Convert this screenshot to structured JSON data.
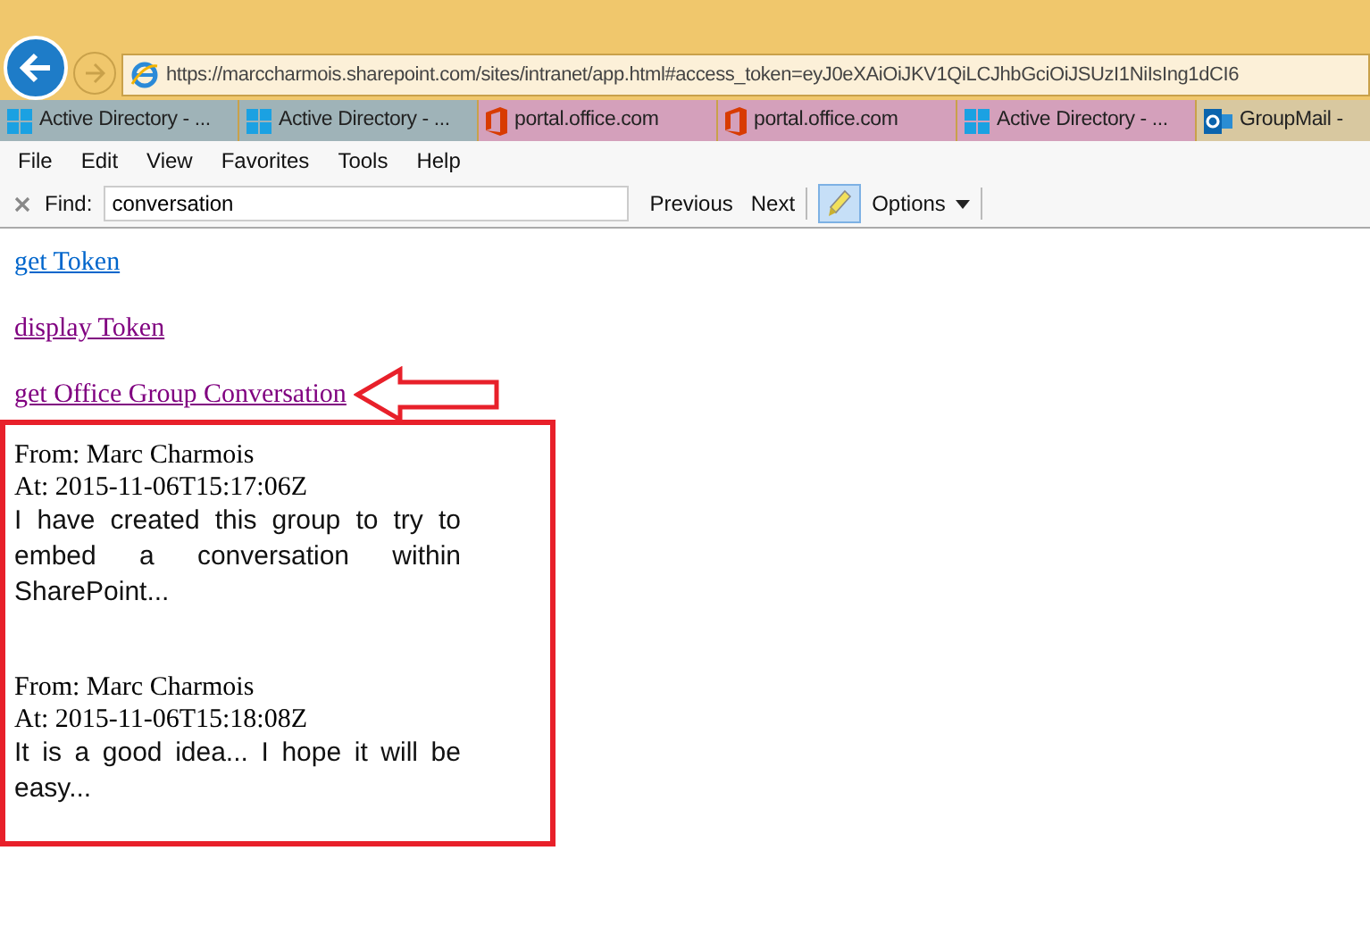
{
  "address_bar": {
    "url": "https://marccharmois.sharepoint.com/sites/intranet/app.html#access_token=eyJ0eXAiOiJKV1QiLCJhbGciOiJSUzI1NiIsIng1dCI6"
  },
  "tabs": [
    {
      "label": "Active Directory - ...",
      "kind": "windows",
      "color": "#9fb3b8"
    },
    {
      "label": "Active Directory - ...",
      "kind": "windows",
      "color": "#9fb3b8"
    },
    {
      "label": "portal.office.com",
      "kind": "office",
      "color": "#d4a0bb"
    },
    {
      "label": "portal.office.com",
      "kind": "office",
      "color": "#d4a0bb"
    },
    {
      "label": "Active Directory - ...",
      "kind": "windows",
      "color": "#d4a0bb"
    },
    {
      "label": "GroupMail -",
      "kind": "outlook",
      "color": "#d8c8a0"
    }
  ],
  "menu": [
    "File",
    "Edit",
    "View",
    "Favorites",
    "Tools",
    "Help"
  ],
  "find_bar": {
    "label": "Find:",
    "value": "conversation",
    "previous": "Previous",
    "next": "Next",
    "options": "Options",
    "highlight_on": true
  },
  "links": [
    {
      "label": "get Token",
      "visited": false,
      "pointed_at": false
    },
    {
      "label": "display Token",
      "visited": true,
      "pointed_at": false
    },
    {
      "label": "get Office Group Conversation",
      "visited": true,
      "pointed_at": true
    }
  ],
  "messages": [
    {
      "from": "From: Marc Charmois",
      "at": "At: 2015-11-06T15:17:06Z",
      "body": "I have created this group to try to embed a conversation within SharePoint..."
    },
    {
      "from": "From: Marc Charmois",
      "at": "At: 2015-11-06T15:18:08Z",
      "body": "It is a good idea... I hope it will be easy..."
    }
  ]
}
